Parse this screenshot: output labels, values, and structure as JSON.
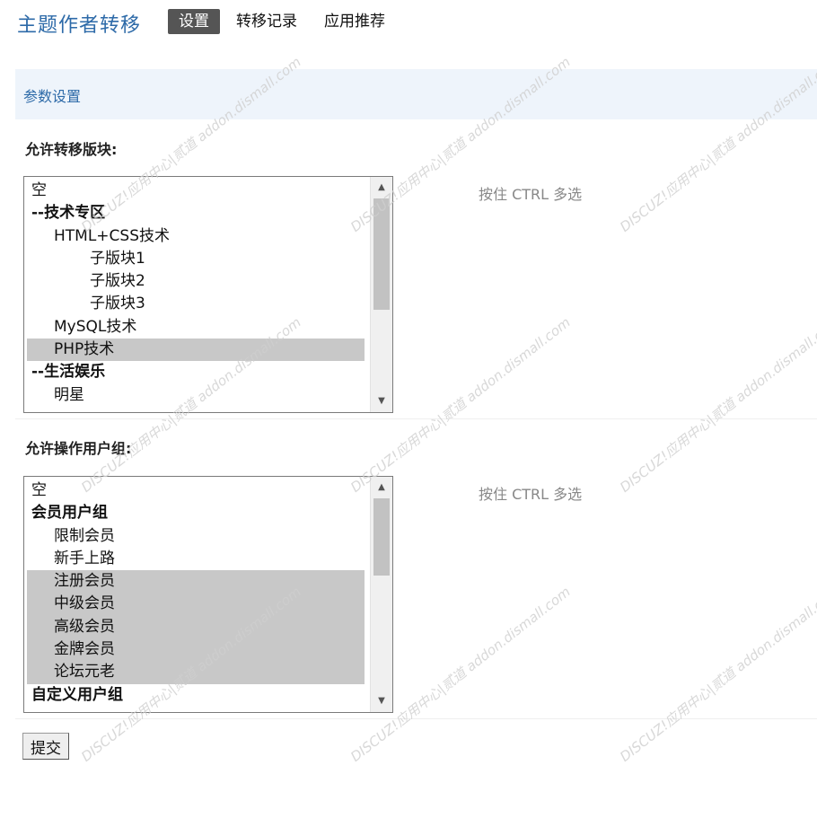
{
  "header": {
    "title": "主题作者转移",
    "tabs": [
      {
        "label": "设置",
        "active": true
      },
      {
        "label": "转移记录",
        "active": false
      },
      {
        "label": "应用推荐",
        "active": false
      }
    ]
  },
  "section": {
    "title": "参数设置"
  },
  "forums": {
    "label": "允许转移版块:",
    "hint": "按住 CTRL 多选",
    "options": [
      {
        "label": "空",
        "level": 0,
        "group": false,
        "selected": false
      },
      {
        "label": "--技术专区",
        "level": 0,
        "group": true,
        "selected": false
      },
      {
        "label": "HTML+CSS技术",
        "level": 1,
        "group": false,
        "selected": false
      },
      {
        "label": "子版块1",
        "level": 2,
        "group": false,
        "selected": false
      },
      {
        "label": "子版块2",
        "level": 2,
        "group": false,
        "selected": false
      },
      {
        "label": "子版块3",
        "level": 2,
        "group": false,
        "selected": false
      },
      {
        "label": "MySQL技术",
        "level": 1,
        "group": false,
        "selected": false
      },
      {
        "label": "PHP技术",
        "level": 1,
        "group": false,
        "selected": true
      },
      {
        "label": "--生活娱乐",
        "level": 0,
        "group": true,
        "selected": false
      },
      {
        "label": "明星",
        "level": 1,
        "group": false,
        "selected": false
      }
    ]
  },
  "usergroups": {
    "label": "允许操作用户组:",
    "hint": "按住 CTRL 多选",
    "options": [
      {
        "label": "空",
        "level": 0,
        "group": false,
        "selected": false
      },
      {
        "label": "会员用户组",
        "level": 0,
        "group": true,
        "selected": false
      },
      {
        "label": "限制会员",
        "level": 1,
        "group": false,
        "selected": false
      },
      {
        "label": "新手上路",
        "level": 1,
        "group": false,
        "selected": false
      },
      {
        "label": "注册会员",
        "level": 1,
        "group": false,
        "selected": true
      },
      {
        "label": "中级会员",
        "level": 1,
        "group": false,
        "selected": true
      },
      {
        "label": "高级会员",
        "level": 1,
        "group": false,
        "selected": true
      },
      {
        "label": "金牌会员",
        "level": 1,
        "group": false,
        "selected": true
      },
      {
        "label": "论坛元老",
        "level": 1,
        "group": false,
        "selected": true
      },
      {
        "label": "自定义用户组",
        "level": 0,
        "group": true,
        "selected": false
      }
    ]
  },
  "submit": {
    "label": "提交"
  },
  "watermark": {
    "text": "DISCUZ!应用中心|贰道 addon.dismall.com"
  }
}
